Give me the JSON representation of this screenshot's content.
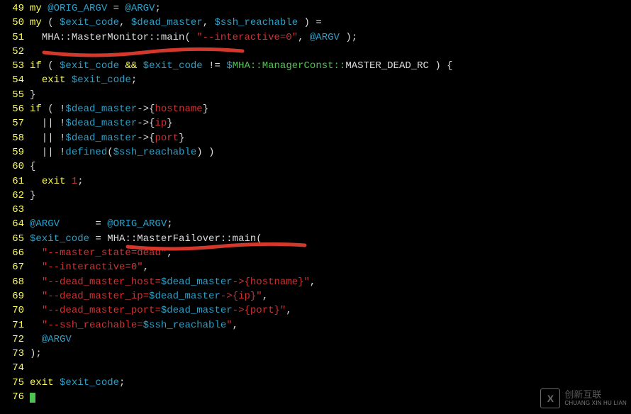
{
  "watermark": {
    "logo": "X",
    "zh": "创新互联",
    "en": "CHUANG XIN HU LIAN"
  },
  "lines": [
    {
      "n": 49,
      "tokens": [
        {
          "c": "kw",
          "t": "my"
        },
        {
          "c": "op",
          "t": " "
        },
        {
          "c": "var",
          "t": "@ORIG_ARGV"
        },
        {
          "c": "op",
          "t": " = "
        },
        {
          "c": "var",
          "t": "@ARGV"
        },
        {
          "c": "op",
          "t": ";"
        }
      ]
    },
    {
      "n": 50,
      "tokens": [
        {
          "c": "kw",
          "t": "my"
        },
        {
          "c": "op",
          "t": " ( "
        },
        {
          "c": "var",
          "t": "$exit_code"
        },
        {
          "c": "op",
          "t": ", "
        },
        {
          "c": "var",
          "t": "$dead_master"
        },
        {
          "c": "op",
          "t": ", "
        },
        {
          "c": "var",
          "t": "$ssh_reachable"
        },
        {
          "c": "op",
          "t": " ) ="
        }
      ]
    },
    {
      "n": 51,
      "tokens": [
        {
          "c": "op",
          "t": "  "
        },
        {
          "c": "pkg",
          "t": "MHA::MasterMonitor::"
        },
        {
          "c": "meth",
          "t": "main"
        },
        {
          "c": "op",
          "t": "( "
        },
        {
          "c": "str",
          "t": "\"--interactive=0\""
        },
        {
          "c": "op",
          "t": ", "
        },
        {
          "c": "var",
          "t": "@ARGV"
        },
        {
          "c": "op",
          "t": " );"
        }
      ]
    },
    {
      "n": 52,
      "tokens": []
    },
    {
      "n": 53,
      "tokens": [
        {
          "c": "kw",
          "t": "if"
        },
        {
          "c": "op",
          "t": " ( "
        },
        {
          "c": "var",
          "t": "$exit_code"
        },
        {
          "c": "op",
          "t": " "
        },
        {
          "c": "kw",
          "t": "&&"
        },
        {
          "c": "op",
          "t": " "
        },
        {
          "c": "var",
          "t": "$exit_code"
        },
        {
          "c": "op",
          "t": " != "
        },
        {
          "c": "var",
          "t": "$"
        },
        {
          "c": "pkggreen",
          "t": "MHA::ManagerConst::"
        },
        {
          "c": "plain",
          "t": "MASTER_DEAD_RC"
        },
        {
          "c": "op",
          "t": " ) {"
        }
      ]
    },
    {
      "n": 54,
      "tokens": [
        {
          "c": "op",
          "t": "  "
        },
        {
          "c": "kw",
          "t": "exit"
        },
        {
          "c": "op",
          "t": " "
        },
        {
          "c": "var",
          "t": "$exit_code"
        },
        {
          "c": "op",
          "t": ";"
        }
      ]
    },
    {
      "n": 55,
      "tokens": [
        {
          "c": "op",
          "t": "}"
        }
      ]
    },
    {
      "n": 56,
      "tokens": [
        {
          "c": "kw",
          "t": "if"
        },
        {
          "c": "op",
          "t": " ( !"
        },
        {
          "c": "var",
          "t": "$dead_master"
        },
        {
          "c": "op",
          "t": "->{"
        },
        {
          "c": "hash",
          "t": "hostname"
        },
        {
          "c": "op",
          "t": "}"
        }
      ]
    },
    {
      "n": 57,
      "tokens": [
        {
          "c": "op",
          "t": "  || !"
        },
        {
          "c": "var",
          "t": "$dead_master"
        },
        {
          "c": "op",
          "t": "->{"
        },
        {
          "c": "hash",
          "t": "ip"
        },
        {
          "c": "op",
          "t": "}"
        }
      ]
    },
    {
      "n": 58,
      "tokens": [
        {
          "c": "op",
          "t": "  || !"
        },
        {
          "c": "var",
          "t": "$dead_master"
        },
        {
          "c": "op",
          "t": "->{"
        },
        {
          "c": "hash",
          "t": "port"
        },
        {
          "c": "op",
          "t": "}"
        }
      ]
    },
    {
      "n": 59,
      "tokens": [
        {
          "c": "op",
          "t": "  || !"
        },
        {
          "c": "fn",
          "t": "defined"
        },
        {
          "c": "op",
          "t": "("
        },
        {
          "c": "var",
          "t": "$ssh_reachable"
        },
        {
          "c": "op",
          "t": ") )"
        }
      ]
    },
    {
      "n": 60,
      "tokens": [
        {
          "c": "op",
          "t": "{"
        }
      ]
    },
    {
      "n": 61,
      "tokens": [
        {
          "c": "op",
          "t": "  "
        },
        {
          "c": "kw",
          "t": "exit"
        },
        {
          "c": "op",
          "t": " "
        },
        {
          "c": "num",
          "t": "1"
        },
        {
          "c": "op",
          "t": ";"
        }
      ]
    },
    {
      "n": 62,
      "tokens": [
        {
          "c": "op",
          "t": "}"
        }
      ]
    },
    {
      "n": 63,
      "tokens": []
    },
    {
      "n": 64,
      "tokens": [
        {
          "c": "var",
          "t": "@ARGV"
        },
        {
          "c": "op",
          "t": "      = "
        },
        {
          "c": "var",
          "t": "@ORIG_ARGV"
        },
        {
          "c": "op",
          "t": ";"
        }
      ]
    },
    {
      "n": 65,
      "tokens": [
        {
          "c": "var",
          "t": "$exit_code"
        },
        {
          "c": "op",
          "t": " = "
        },
        {
          "c": "pkg",
          "t": "MHA::MasterFailover::"
        },
        {
          "c": "meth",
          "t": "main"
        },
        {
          "c": "op",
          "t": "("
        }
      ]
    },
    {
      "n": 66,
      "tokens": [
        {
          "c": "op",
          "t": "  "
        },
        {
          "c": "str",
          "t": "\"--master_state=dead\""
        },
        {
          "c": "op",
          "t": ","
        }
      ]
    },
    {
      "n": 67,
      "tokens": [
        {
          "c": "op",
          "t": "  "
        },
        {
          "c": "str",
          "t": "\"--interactive=0\""
        },
        {
          "c": "op",
          "t": ","
        }
      ]
    },
    {
      "n": 68,
      "tokens": [
        {
          "c": "op",
          "t": "  "
        },
        {
          "c": "str",
          "t": "\"--dead_master_host="
        },
        {
          "c": "var",
          "t": "$dead_master"
        },
        {
          "c": "str",
          "t": "->{"
        },
        {
          "c": "hash",
          "t": "hostname"
        },
        {
          "c": "str",
          "t": "}\""
        },
        {
          "c": "op",
          "t": ","
        }
      ]
    },
    {
      "n": 69,
      "tokens": [
        {
          "c": "op",
          "t": "  "
        },
        {
          "c": "str",
          "t": "\"--dead_master_ip="
        },
        {
          "c": "var",
          "t": "$dead_master"
        },
        {
          "c": "str",
          "t": "->{"
        },
        {
          "c": "hash",
          "t": "ip"
        },
        {
          "c": "str",
          "t": "}\""
        },
        {
          "c": "op",
          "t": ","
        }
      ]
    },
    {
      "n": 70,
      "tokens": [
        {
          "c": "op",
          "t": "  "
        },
        {
          "c": "str",
          "t": "\"--dead_master_port="
        },
        {
          "c": "var",
          "t": "$dead_master"
        },
        {
          "c": "str",
          "t": "->{"
        },
        {
          "c": "hash",
          "t": "port"
        },
        {
          "c": "str",
          "t": "}\""
        },
        {
          "c": "op",
          "t": ","
        }
      ]
    },
    {
      "n": 71,
      "tokens": [
        {
          "c": "op",
          "t": "  "
        },
        {
          "c": "str",
          "t": "\"--ssh_reachable="
        },
        {
          "c": "var",
          "t": "$ssh_reachable"
        },
        {
          "c": "str",
          "t": "\""
        },
        {
          "c": "op",
          "t": ","
        }
      ]
    },
    {
      "n": 72,
      "tokens": [
        {
          "c": "op",
          "t": "  "
        },
        {
          "c": "var",
          "t": "@ARGV"
        }
      ]
    },
    {
      "n": 73,
      "tokens": [
        {
          "c": "op",
          "t": ");"
        }
      ]
    },
    {
      "n": 74,
      "tokens": []
    },
    {
      "n": 75,
      "tokens": [
        {
          "c": "kw",
          "t": "exit"
        },
        {
          "c": "op",
          "t": " "
        },
        {
          "c": "var",
          "t": "$exit_code"
        },
        {
          "c": "op",
          "t": ";"
        }
      ]
    },
    {
      "n": 76,
      "tokens": [
        {
          "c": "cursor",
          "t": ""
        }
      ]
    }
  ]
}
